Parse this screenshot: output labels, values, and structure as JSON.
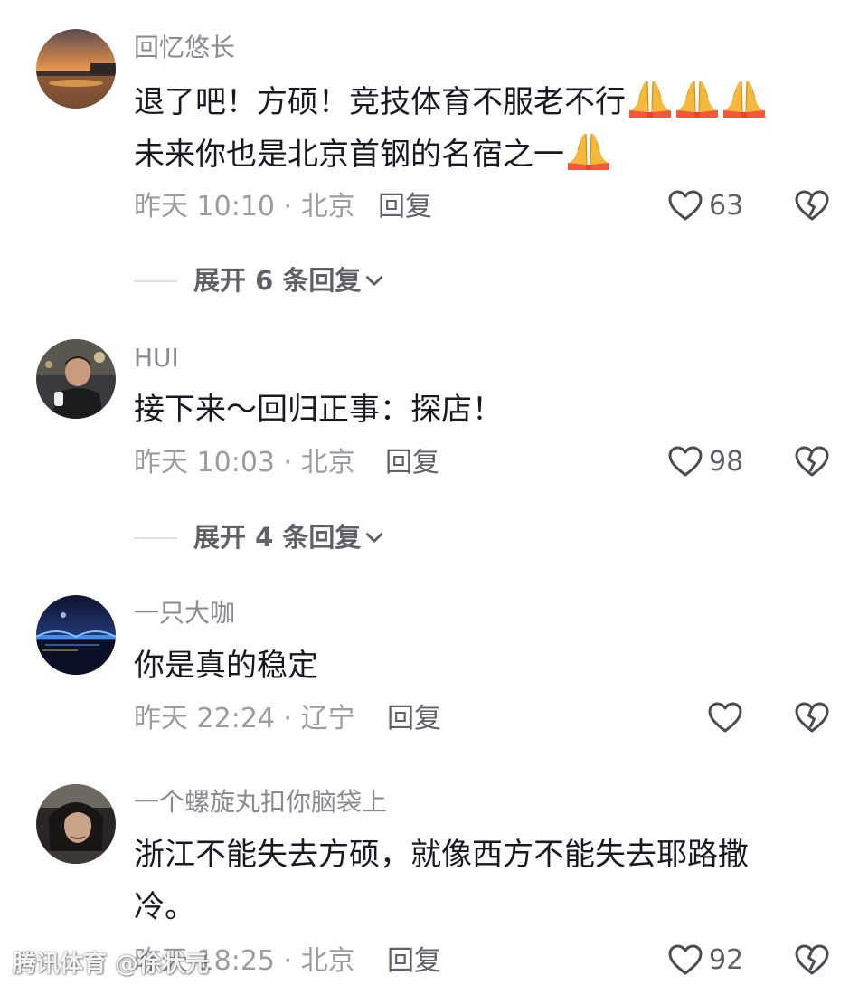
{
  "comments": [
    {
      "username": "回忆悠长",
      "line1": "退了吧！方硕！竞技体育不服老不行",
      "line2": "未来你也是北京首钢的名宿之一",
      "meta": "昨天 10:10 · 北京",
      "reply_label": "回复",
      "likes": "63",
      "expand_label": "展开 6 条回复",
      "avatar_icon": "sunset-avatar"
    },
    {
      "username": "HUI",
      "line1": "接下来～回归正事：探店！",
      "meta": "昨天 10:03 · 北京",
      "reply_label": "回复",
      "likes": "98",
      "expand_label": "展开 4 条回复",
      "avatar_icon": "man-night-avatar"
    },
    {
      "username": "一只大咖",
      "line1": "你是真的稳定",
      "meta": "昨天 22:24 · 辽宁",
      "reply_label": "回复",
      "likes": "",
      "avatar_icon": "bridge-night-avatar"
    },
    {
      "username": "一个螺旋丸扣你脑袋上",
      "line1": "浙江不能失去方硕，就像西方不能失去耶路撒",
      "line2": "冷。",
      "meta": "昨天 18:25 · 北京",
      "reply_label": "回复",
      "likes": "92",
      "avatar_icon": "long-hair-person-avatar"
    }
  ],
  "watermark": "腾讯体育 @徐状元",
  "icons": {
    "like": "heart-outline-icon",
    "dislike": "broken-heart-icon",
    "expand": "chevron-down-icon",
    "emoji": "folded-hands-emoji"
  },
  "colors": {
    "text": "#161823",
    "secondary": "#8a8b91",
    "action": "#5f6068",
    "icon": "#4a4b53"
  }
}
